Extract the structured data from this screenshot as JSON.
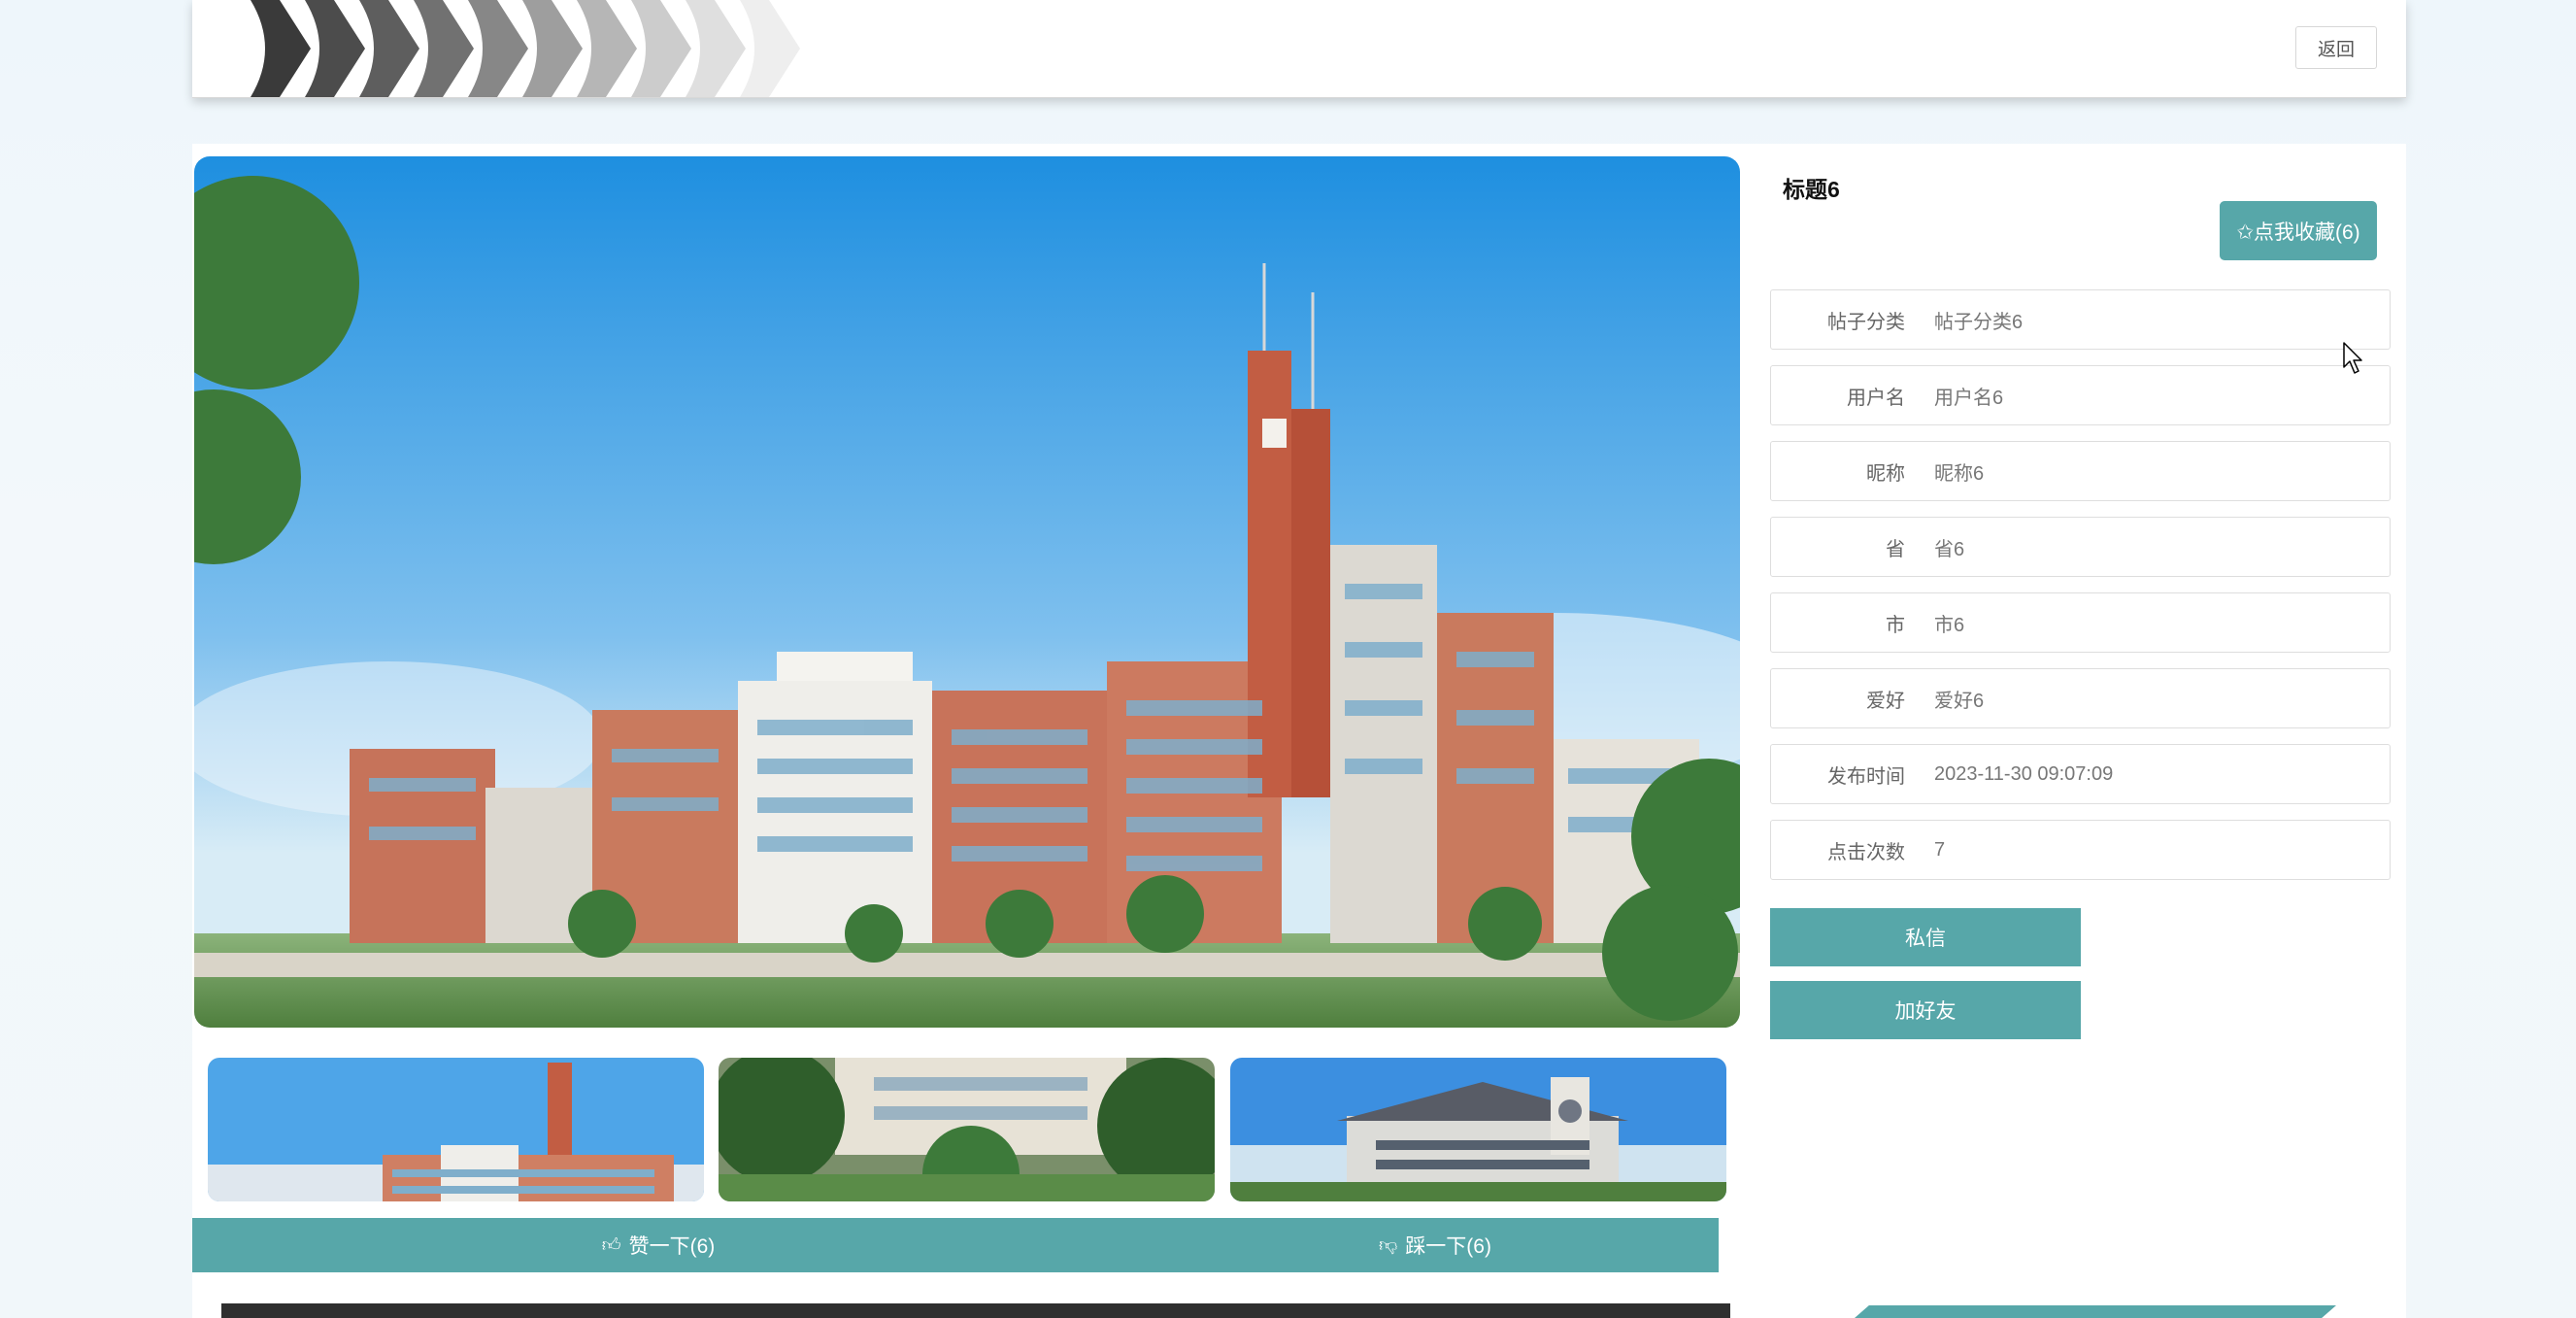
{
  "header": {
    "back_label": "返回"
  },
  "post": {
    "title": "标题6",
    "favorite_label": "✩点我收藏(6)"
  },
  "info_fields": [
    {
      "label": "帖子分类",
      "value": "帖子分类6"
    },
    {
      "label": "用户名",
      "value": "用户名6"
    },
    {
      "label": "昵称",
      "value": "昵称6"
    },
    {
      "label": "省",
      "value": "省6"
    },
    {
      "label": "市",
      "value": "市6"
    },
    {
      "label": "爱好",
      "value": "爱好6"
    },
    {
      "label": "发布时间",
      "value": "2023-11-30 09:07:09"
    },
    {
      "label": "点击次数",
      "value": "7"
    }
  ],
  "actions": {
    "message_label": "私信",
    "add_friend_label": "加好友"
  },
  "votes": {
    "like_label": "赞一下(6)",
    "dislike_label": "踩一下(6)"
  },
  "icons": {
    "like": "thumbs-up-icon",
    "dislike": "thumbs-down-icon",
    "cursor": "mouse-pointer-icon"
  },
  "colors": {
    "accent": "#57a7a9",
    "background": "#eef6fb"
  }
}
